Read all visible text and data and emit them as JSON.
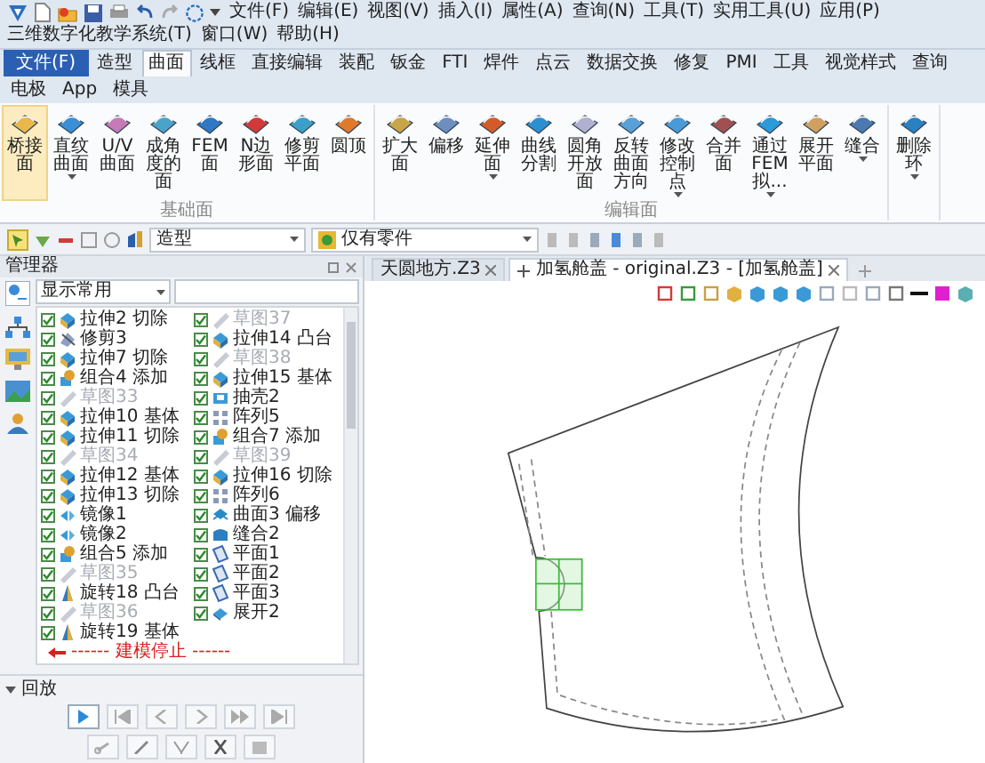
{
  "menu_bar": {
    "items": [
      "文件(F)",
      "编辑(E)",
      "视图(V)",
      "插入(I)",
      "属性(A)",
      "查询(N)",
      "工具(T)",
      "实用工具(U)",
      "应用(P)",
      "三维数字化教学系统(T)",
      "窗口(W)",
      "帮助(H)"
    ]
  },
  "ribbon_tabs": [
    {
      "label": "文件(F)",
      "kind": "file",
      "selected": false
    },
    {
      "label": "造型",
      "kind": "tab",
      "selected": false
    },
    {
      "label": "曲面",
      "kind": "tab",
      "selected": true
    },
    {
      "label": "线框",
      "kind": "tab",
      "selected": false
    },
    {
      "label": "直接编辑",
      "kind": "tab",
      "selected": false
    },
    {
      "label": "装配",
      "kind": "tab",
      "selected": false
    },
    {
      "label": "钣金",
      "kind": "tab",
      "selected": false
    },
    {
      "label": "FTI",
      "kind": "tab",
      "selected": false
    },
    {
      "label": "焊件",
      "kind": "tab",
      "selected": false
    },
    {
      "label": "点云",
      "kind": "tab",
      "selected": false
    },
    {
      "label": "数据交换",
      "kind": "tab",
      "selected": false
    },
    {
      "label": "修复",
      "kind": "tab",
      "selected": false
    },
    {
      "label": "PMI",
      "kind": "tab",
      "selected": false
    },
    {
      "label": "工具",
      "kind": "tab",
      "selected": false
    },
    {
      "label": "视觉样式",
      "kind": "tab",
      "selected": false
    },
    {
      "label": "查询",
      "kind": "tab",
      "selected": false
    },
    {
      "label": "电极",
      "kind": "tab",
      "selected": false
    },
    {
      "label": "App",
      "kind": "tab",
      "selected": false
    },
    {
      "label": "模具",
      "kind": "tab",
      "selected": false
    }
  ],
  "ribbon_groups": [
    {
      "label": "基础面",
      "buttons": [
        {
          "label": "桥接面",
          "selected": true,
          "dropdown": false
        },
        {
          "label": "直纹曲面",
          "selected": false,
          "dropdown": true
        },
        {
          "label": "U/V曲面",
          "selected": false,
          "dropdown": false
        },
        {
          "label": "成角度的面",
          "selected": false,
          "dropdown": false
        },
        {
          "label": "FEM面",
          "selected": false,
          "dropdown": false
        },
        {
          "label": "N边形面",
          "selected": false,
          "dropdown": false
        },
        {
          "label": "修剪平面",
          "selected": false,
          "dropdown": false
        },
        {
          "label": "圆顶",
          "selected": false,
          "dropdown": false
        }
      ]
    },
    {
      "label": "编辑面",
      "buttons": [
        {
          "label": "扩大面",
          "selected": false,
          "dropdown": false
        },
        {
          "label": "偏移",
          "selected": false,
          "dropdown": false
        },
        {
          "label": "延伸面",
          "selected": false,
          "dropdown": true
        },
        {
          "label": "曲线分割",
          "selected": false,
          "dropdown": false
        },
        {
          "label": "圆角开放面",
          "selected": false,
          "dropdown": false
        },
        {
          "label": "反转曲面方向",
          "selected": false,
          "dropdown": false
        },
        {
          "label": "修改控制点",
          "selected": false,
          "dropdown": true
        },
        {
          "label": "合并面",
          "selected": false,
          "dropdown": false
        },
        {
          "label": "通过FEM拟...",
          "selected": false,
          "dropdown": true
        },
        {
          "label": "展开平面",
          "selected": false,
          "dropdown": false
        },
        {
          "label": "缝合",
          "selected": false,
          "dropdown": true
        }
      ]
    },
    {
      "buttons": [
        {
          "label": "删除环",
          "selected": false,
          "dropdown": true
        }
      ]
    }
  ],
  "toolbar": {
    "mode": "造型",
    "filter": "仅有零件"
  },
  "doc_tabs": [
    {
      "label": "天圆地方.Z3",
      "selected": false
    },
    {
      "label": "加氢舱盖 - original.Z3 - [加氢舱盖]",
      "selected": true
    }
  ],
  "manager": {
    "title": "管理器",
    "view_filter": "显示常用",
    "tree": [
      {
        "label": "拉伸2 切除",
        "kind": "extrude",
        "checked": true,
        "dimmed": false
      },
      {
        "label": "修剪3",
        "kind": "trim",
        "checked": true,
        "dimmed": false
      },
      {
        "label": "拉伸7 切除",
        "kind": "extrude",
        "checked": true,
        "dimmed": false
      },
      {
        "label": "组合4 添加",
        "kind": "combine",
        "checked": true,
        "dimmed": false
      },
      {
        "label": "草图33",
        "kind": "sketch",
        "checked": true,
        "dimmed": true
      },
      {
        "label": "拉伸10 基体",
        "kind": "extrude",
        "checked": true,
        "dimmed": false
      },
      {
        "label": "拉伸11 切除",
        "kind": "extrude",
        "checked": true,
        "dimmed": false
      },
      {
        "label": "草图34",
        "kind": "sketch",
        "checked": true,
        "dimmed": true
      },
      {
        "label": "拉伸12 基体",
        "kind": "extrude",
        "checked": true,
        "dimmed": false
      },
      {
        "label": "拉伸13 切除",
        "kind": "extrude",
        "checked": true,
        "dimmed": false
      },
      {
        "label": "镜像1",
        "kind": "mirror",
        "checked": true,
        "dimmed": false
      },
      {
        "label": "镜像2",
        "kind": "mirror",
        "checked": true,
        "dimmed": false
      },
      {
        "label": "组合5 添加",
        "kind": "combine",
        "checked": true,
        "dimmed": false
      },
      {
        "label": "草图35",
        "kind": "sketch",
        "checked": true,
        "dimmed": true
      },
      {
        "label": "旋转18 凸台",
        "kind": "revolve",
        "checked": true,
        "dimmed": false
      },
      {
        "label": "草图36",
        "kind": "sketch",
        "checked": true,
        "dimmed": true
      },
      {
        "label": "旋转19 基体",
        "kind": "revolve",
        "checked": true,
        "dimmed": false
      },
      {
        "label": "草图37",
        "kind": "sketch",
        "checked": true,
        "dimmed": true
      },
      {
        "label": "拉伸14 凸台",
        "kind": "extrude",
        "checked": true,
        "dimmed": false
      },
      {
        "label": "草图38",
        "kind": "sketch",
        "checked": true,
        "dimmed": true
      },
      {
        "label": "拉伸15 基体",
        "kind": "extrude",
        "checked": true,
        "dimmed": false
      },
      {
        "label": "抽壳2",
        "kind": "shell",
        "checked": true,
        "dimmed": false
      },
      {
        "label": "阵列5",
        "kind": "pattern",
        "checked": true,
        "dimmed": false
      },
      {
        "label": "组合7 添加",
        "kind": "combine",
        "checked": true,
        "dimmed": false
      },
      {
        "label": "草图39",
        "kind": "sketch",
        "checked": true,
        "dimmed": true
      },
      {
        "label": "拉伸16 切除",
        "kind": "extrude",
        "checked": true,
        "dimmed": false
      },
      {
        "label": "阵列6",
        "kind": "pattern",
        "checked": true,
        "dimmed": false
      },
      {
        "label": "曲面3 偏移",
        "kind": "offset",
        "checked": true,
        "dimmed": false
      },
      {
        "label": "缝合2",
        "kind": "sew",
        "checked": true,
        "dimmed": false
      },
      {
        "label": "平面1",
        "kind": "plane",
        "checked": true,
        "dimmed": false
      },
      {
        "label": "平面2",
        "kind": "plane",
        "checked": true,
        "dimmed": false
      },
      {
        "label": "平面3",
        "kind": "plane",
        "checked": true,
        "dimmed": false
      },
      {
        "label": "展开2",
        "kind": "unfold",
        "checked": true,
        "dimmed": false
      }
    ],
    "stop_marker": "------ 建模停止 ------",
    "playback": {
      "title": "回放"
    }
  }
}
